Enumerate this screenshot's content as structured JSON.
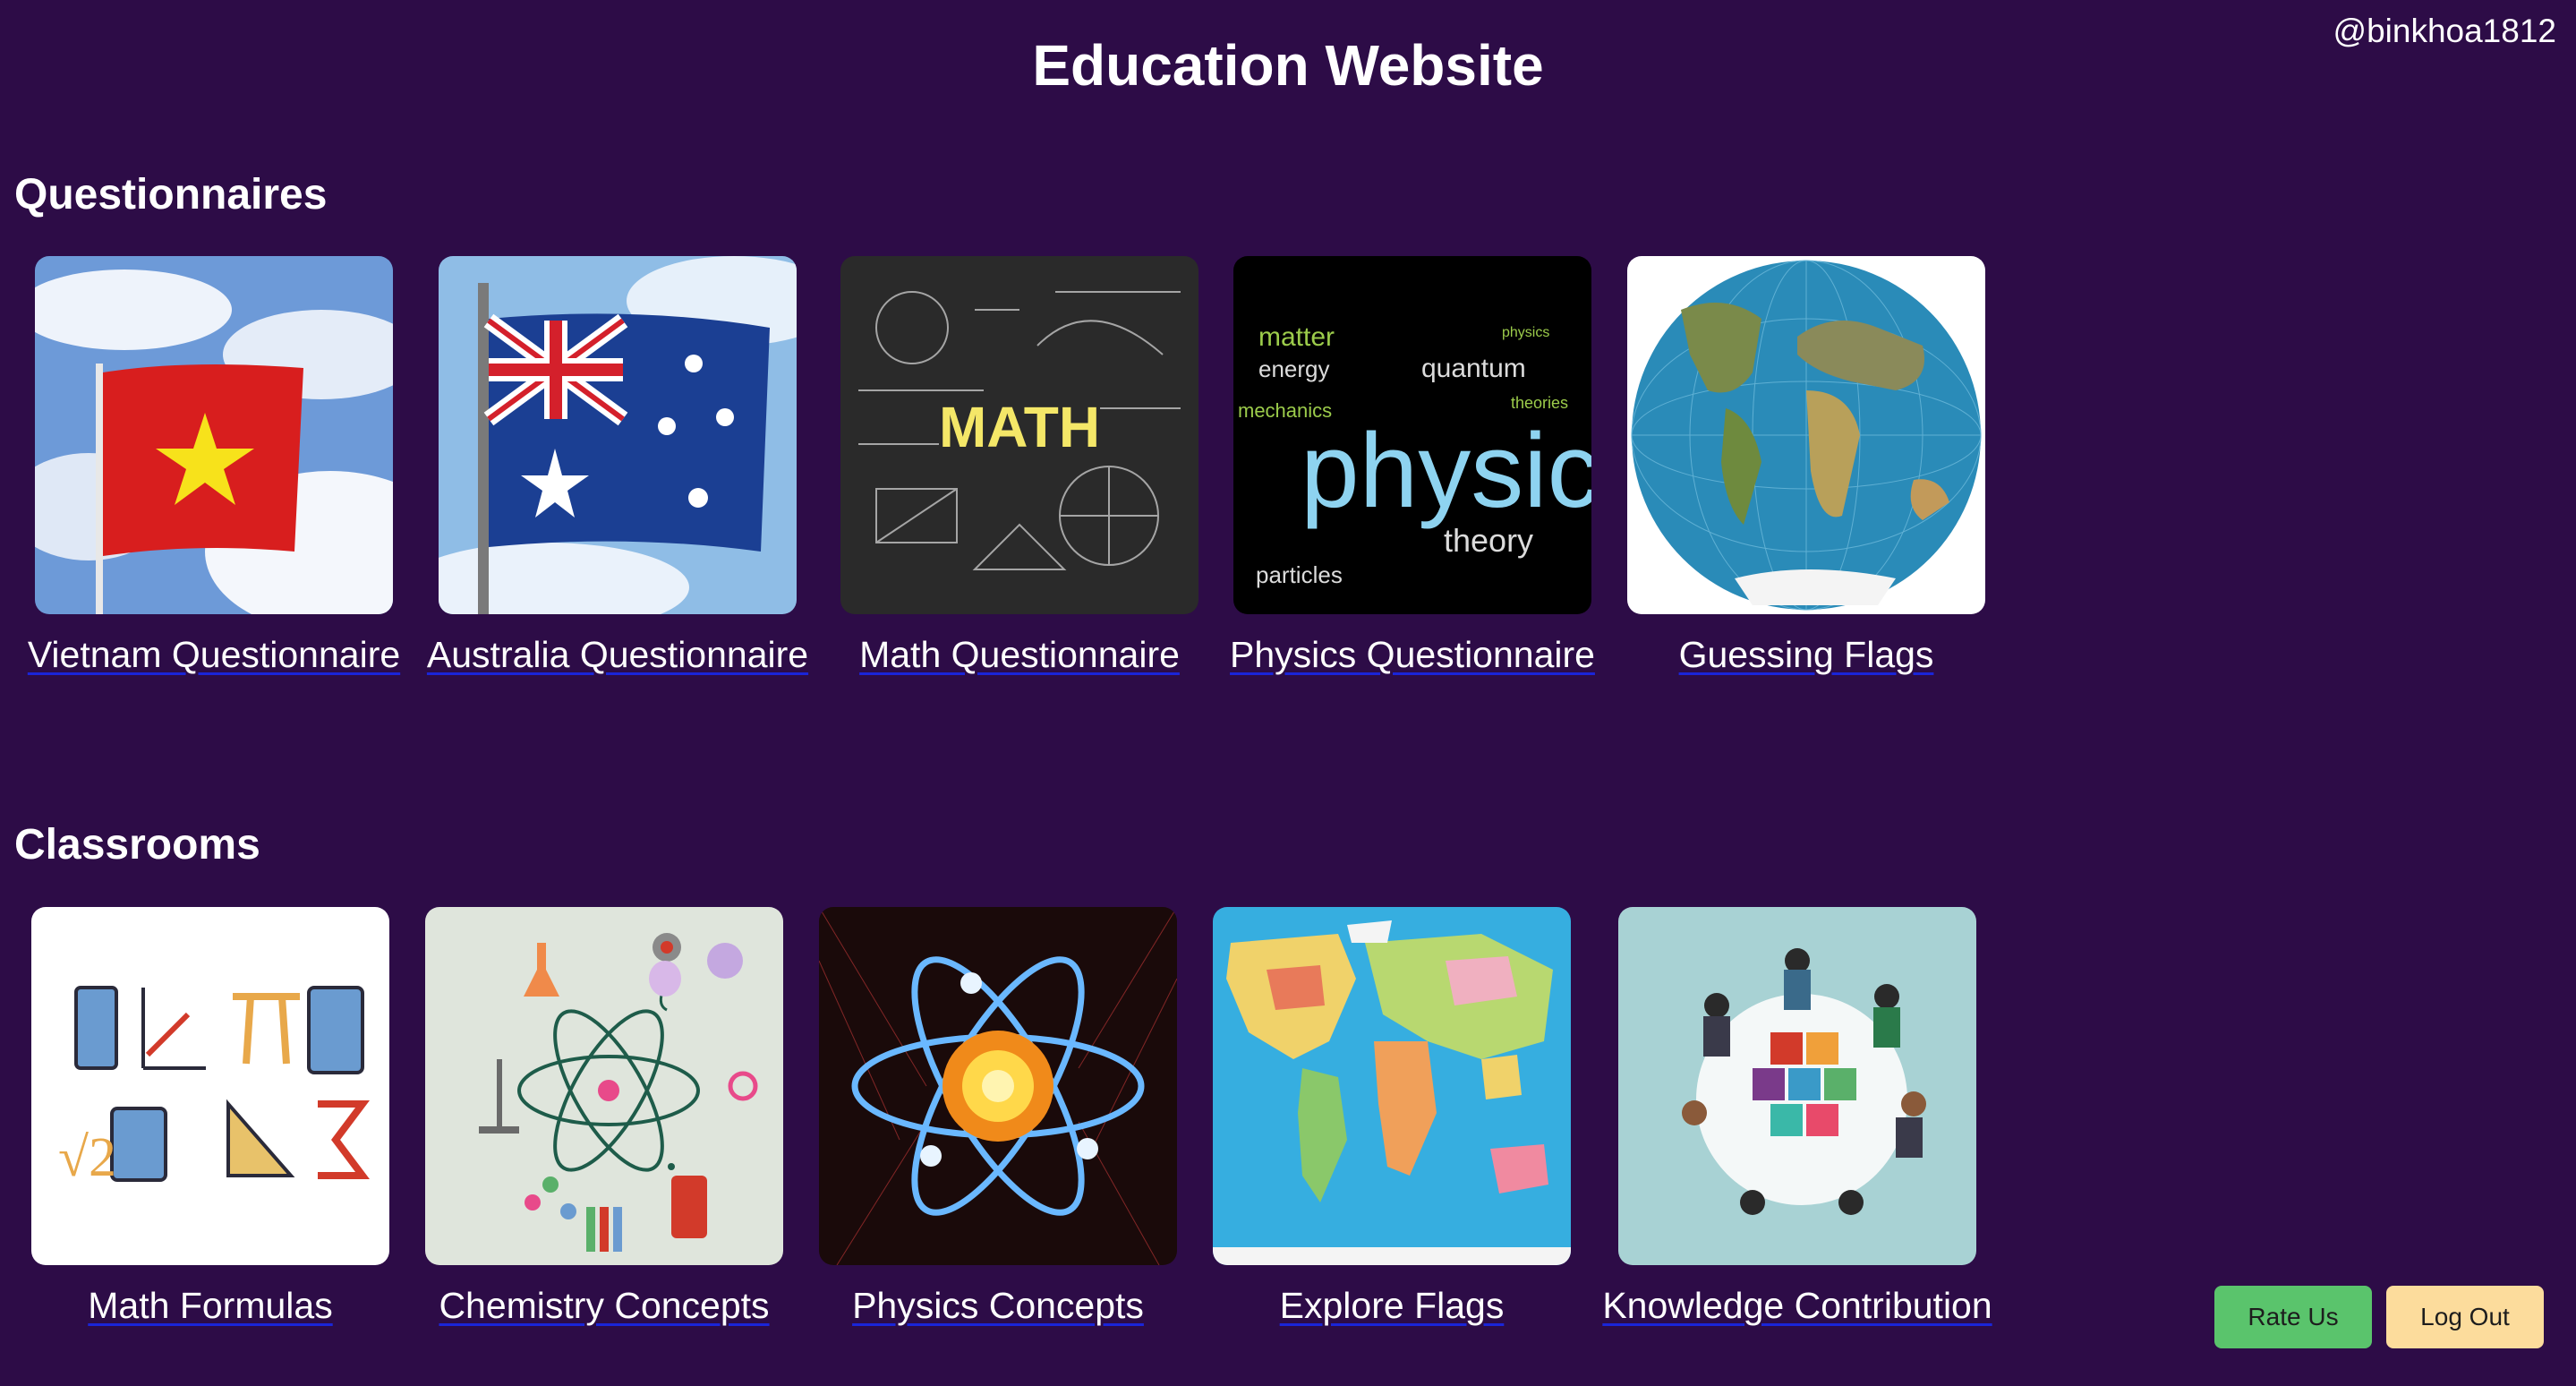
{
  "header": {
    "title": "Education Website",
    "user_handle": "@binkhoa1812"
  },
  "questionnaires": {
    "heading": "Questionnaires",
    "items": [
      {
        "label": "Vietnam Questionnaire",
        "image": "vietnam-flag"
      },
      {
        "label": "Australia Questionnaire",
        "image": "australia-flag"
      },
      {
        "label": "Math Questionnaire",
        "image": "math-chalkboard"
      },
      {
        "label": "Physics Questionnaire",
        "image": "physics-word-cloud"
      },
      {
        "label": "Guessing Flags",
        "image": "world-globe"
      }
    ]
  },
  "classrooms": {
    "heading": "Classrooms",
    "items": [
      {
        "label": "Math Formulas",
        "image": "math-icons"
      },
      {
        "label": "Chemistry Concepts",
        "image": "chemistry-icons"
      },
      {
        "label": "Physics Concepts",
        "image": "atom"
      },
      {
        "label": "Explore Flags",
        "image": "world-map"
      },
      {
        "label": "Knowledge Contribution",
        "image": "puzzle-team"
      }
    ]
  },
  "actions": {
    "rate_label": "Rate Us",
    "logout_label": "Log Out"
  },
  "colors": {
    "background": "#2d0c47",
    "link_underline": "#1a25d8",
    "rate_button": "#5ac46c",
    "logout_button": "#fcdc9c"
  }
}
